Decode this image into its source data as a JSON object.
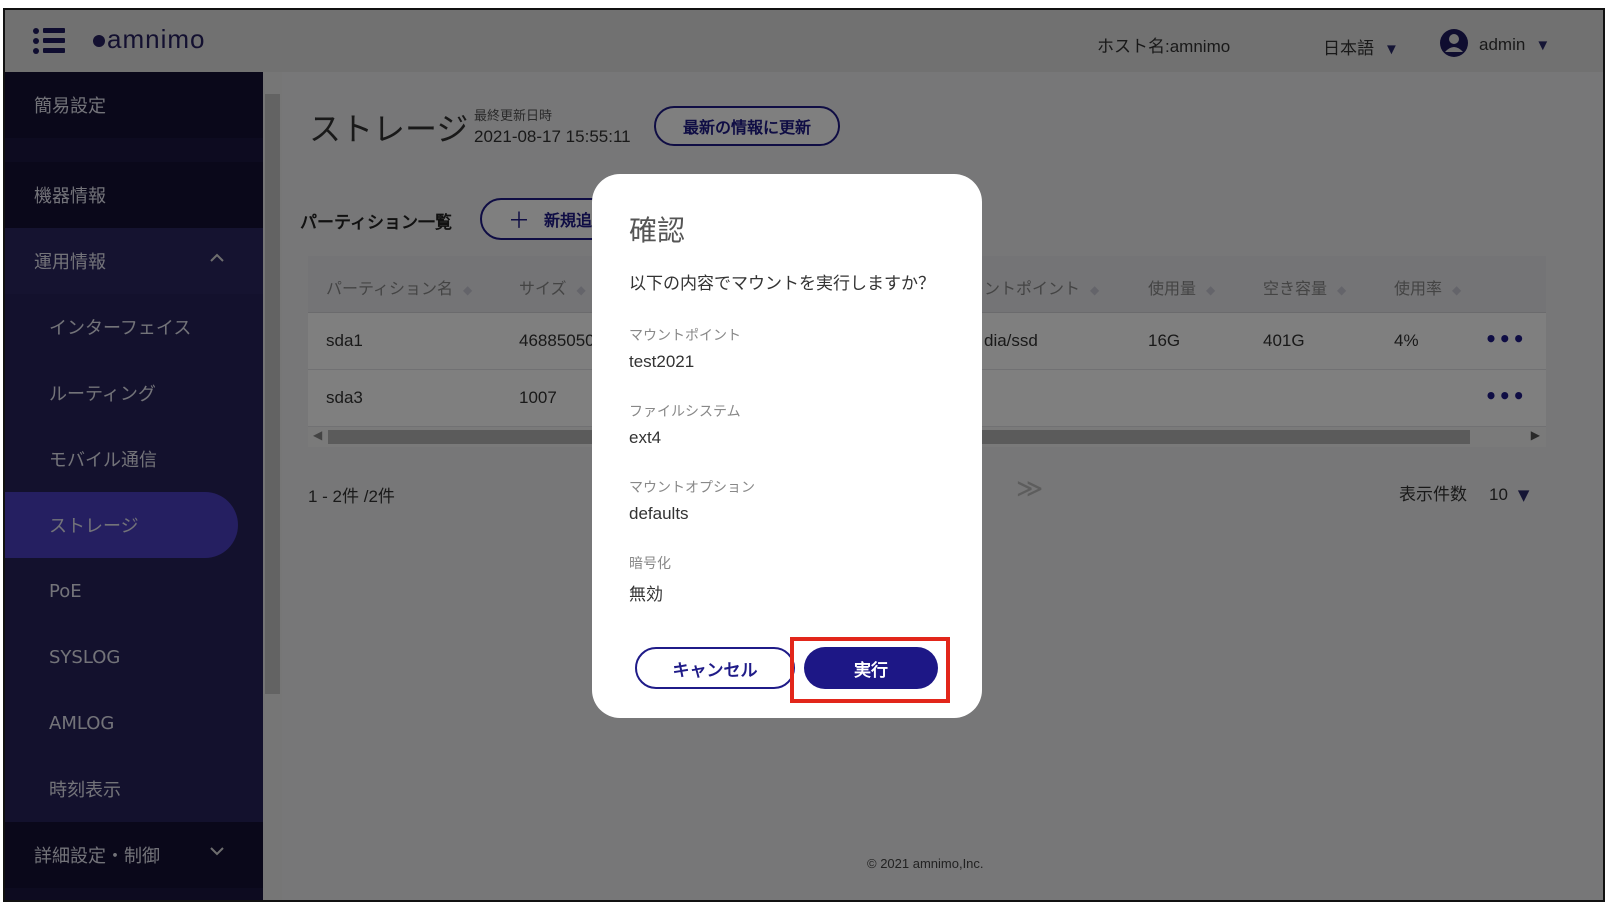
{
  "header": {
    "logo_text": "amnimo",
    "hostname": "ホスト名:amnimo",
    "language": "日本語",
    "user": "admin"
  },
  "sidebar": {
    "items": [
      {
        "label": "簡易設定",
        "type": "top"
      },
      {
        "label": "機器情報",
        "type": "top"
      },
      {
        "label": "運用情報",
        "type": "top",
        "expanded": true
      },
      {
        "label": "インターフェイス",
        "type": "sub"
      },
      {
        "label": "ルーティング",
        "type": "sub"
      },
      {
        "label": "モバイル通信",
        "type": "sub"
      },
      {
        "label": "ストレージ",
        "type": "sub",
        "active": true
      },
      {
        "label": "PoE",
        "type": "sub"
      },
      {
        "label": "SYSLOG",
        "type": "sub"
      },
      {
        "label": "AMLOG",
        "type": "sub"
      },
      {
        "label": "時刻表示",
        "type": "sub"
      },
      {
        "label": "詳細設定・制御",
        "type": "top",
        "expanded": false
      }
    ]
  },
  "page": {
    "title": "ストレージ",
    "updated_label": "最終更新日時",
    "updated_value": "2021-08-17 15:55:11",
    "refresh_label": "最新の情報に更新",
    "section_title": "パーティション一覧",
    "add_label": "新規追"
  },
  "table": {
    "columns": [
      "パーティション名",
      "サイズ",
      "ントポイント",
      "使用量",
      "空き容量",
      "使用率"
    ],
    "rows": [
      [
        "sda1",
        "46885050",
        "dia/ssd",
        "16G",
        "401G",
        "4%"
      ],
      [
        "sda3",
        "1007",
        "",
        "",
        "",
        ""
      ]
    ]
  },
  "pagination": {
    "count": "1 - 2件 /2件",
    "next": "≫",
    "per_page_label": "表示件数",
    "per_page_value": "10"
  },
  "footer": "© 2021 amnimo,Inc.",
  "modal": {
    "title": "確認",
    "message": "以下の内容でマウントを実行しますか？",
    "fields": [
      {
        "label": "マウントポイント",
        "value": "test2021"
      },
      {
        "label": "ファイルシステム",
        "value": "ext4"
      },
      {
        "label": "マウントオプション",
        "value": "defaults"
      },
      {
        "label": "暗号化",
        "value": "無効"
      }
    ],
    "cancel_label": "キャンセル",
    "execute_label": "実行"
  },
  "colors": {
    "sidebar_bg": "#1a1740",
    "active_item": "#4a3ec2",
    "accent": "#1f1b88",
    "highlight": "#e2261a"
  }
}
